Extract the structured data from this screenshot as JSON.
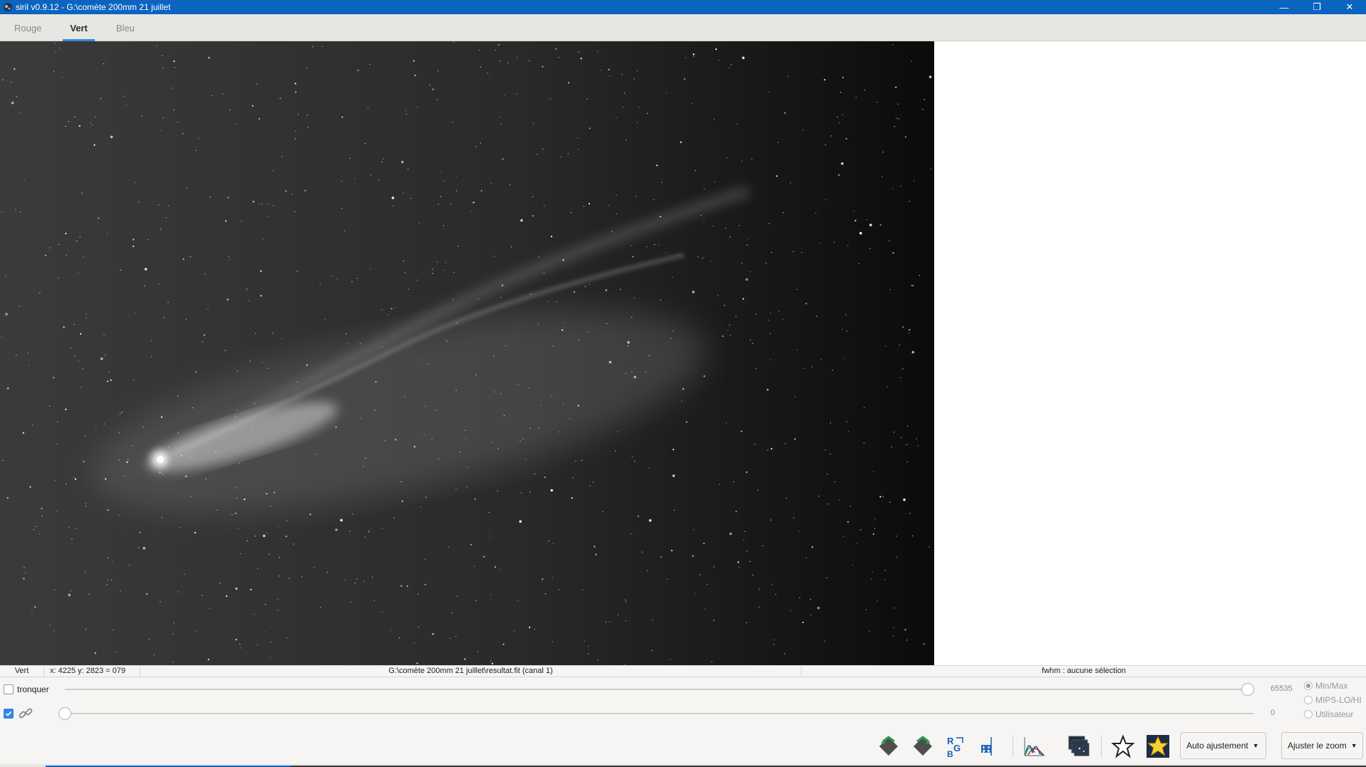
{
  "window": {
    "title": "siril v0.9.12 - G:\\comète 200mm 21 juillet",
    "controls": {
      "minimize": "—",
      "restore": "❐",
      "close": "✕"
    }
  },
  "tabs": [
    {
      "label": "Rouge",
      "active": false
    },
    {
      "label": "Vert",
      "active": true
    },
    {
      "label": "Bleu",
      "active": false
    }
  ],
  "status": {
    "channel": "Vert",
    "coords": "x: 4225 y: 2823 = 079",
    "file": "G:\\comète 200mm 21 juillet\\resultat.fit (canal 1)",
    "fwhm": "fwhm : aucune sélection"
  },
  "sliders": {
    "high": {
      "checkbox_label": "tronquer",
      "value": "65535",
      "fraction": 1.0
    },
    "low": {
      "value": "0",
      "fraction": 0.0
    }
  },
  "radio_options": [
    {
      "label": "Min/Max",
      "selected": true
    },
    {
      "label": "MIPS-LO/HI",
      "selected": false
    },
    {
      "label": "Utilisateur",
      "selected": false
    }
  ],
  "toolbar": {
    "auto_adjust": "Auto ajustement",
    "zoom_fit": "Ajuster le zoom",
    "rgb_left_label": "R G B",
    "rgb_right_label": "R R"
  },
  "colors": {
    "titlebar": "#0b64c0",
    "accent": "#3584e4"
  }
}
